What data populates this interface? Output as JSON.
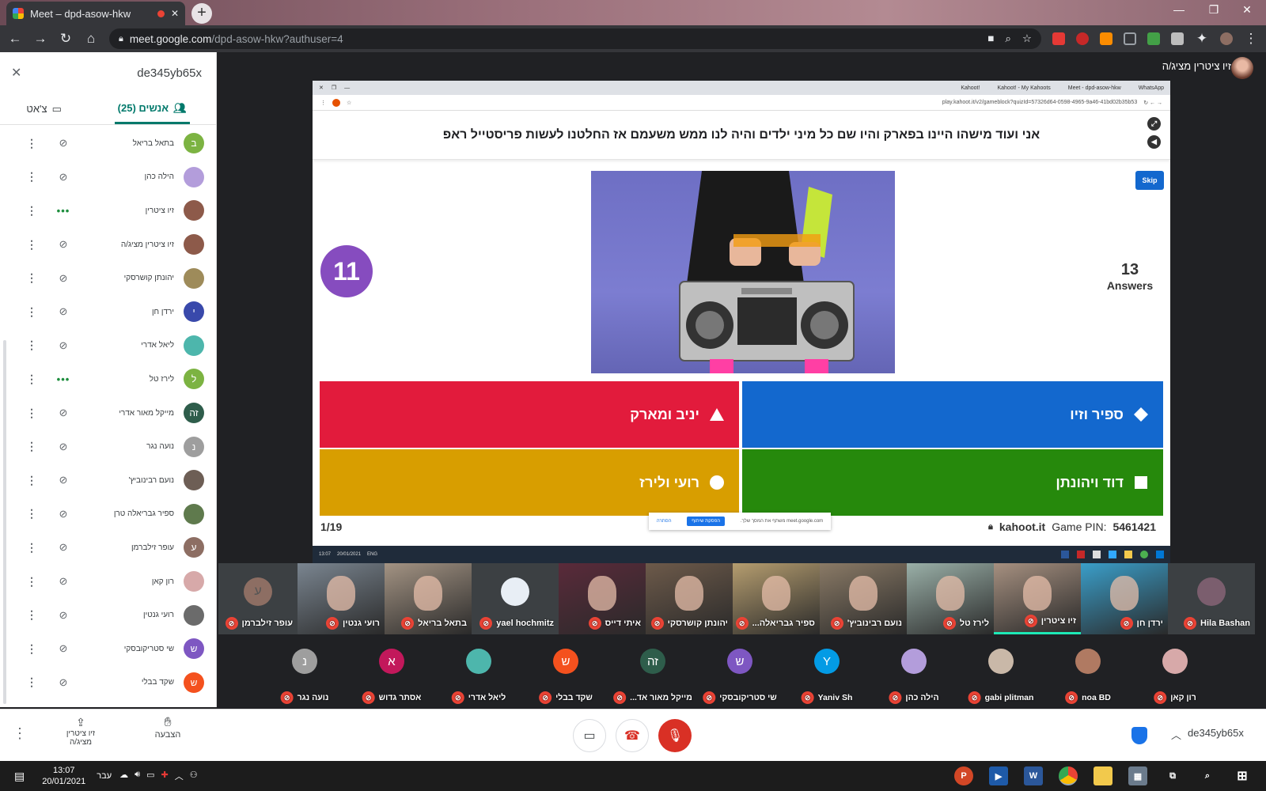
{
  "browser": {
    "tab_title": "Meet – dpd-asow-hkw",
    "new_tab": "+",
    "url_host": "meet.google.com",
    "url_path": "/dpd-asow-hkw?authuser=4",
    "win_min": "—",
    "win_restore": "❐",
    "win_close": "✕",
    "tab_close": "✕"
  },
  "panel": {
    "meeting_code": "de345yb65x",
    "close": "✕",
    "tab_people": "אנשים (25)",
    "tab_chat": "צ'אט",
    "participants": [
      {
        "name": "בתאל בריאל",
        "initial": "ב",
        "color": "#7cb342",
        "mic": "muted"
      },
      {
        "name": "הילה כהן",
        "initial": "",
        "color": "#b39ddb",
        "mic": "muted"
      },
      {
        "name": "זיו ציטרין",
        "initial": "",
        "color": "#8d5a4a",
        "mic": "talking"
      },
      {
        "name": "זיו ציטרין מציג/ה",
        "initial": "",
        "color": "#8d5a4a",
        "mic": "present"
      },
      {
        "name": "יהונתן קושרסקי",
        "initial": "",
        "color": "#9e8b5a",
        "mic": "muted"
      },
      {
        "name": "ירדן חן",
        "initial": "י",
        "color": "#3949ab",
        "mic": "muted"
      },
      {
        "name": "ליאל אדרי",
        "initial": "",
        "color": "#4db6ac",
        "mic": "muted"
      },
      {
        "name": "לירז טל",
        "initial": "ל",
        "color": "#7cb342",
        "mic": "talking"
      },
      {
        "name": "מייקל מאור אדרי",
        "initial": "זה",
        "color": "#2e5d4b",
        "mic": "muted"
      },
      {
        "name": "נועה נגר",
        "initial": "נ",
        "color": "#9e9e9e",
        "mic": "muted"
      },
      {
        "name": "נועם רבינוביץ'",
        "initial": "",
        "color": "#6d5e55",
        "mic": "muted"
      },
      {
        "name": "ספיר גבריאלה טרן",
        "initial": "",
        "color": "#5f7a4d",
        "mic": "muted"
      },
      {
        "name": "עופר זילברמן",
        "initial": "ע",
        "color": "#8d6e63",
        "mic": "muted"
      },
      {
        "name": "רון קאן",
        "initial": "",
        "color": "#d7a9a9",
        "mic": "muted"
      },
      {
        "name": "רועי גנטין",
        "initial": "",
        "color": "#6b6b6b",
        "mic": "muted"
      },
      {
        "name": "שי סטריקובסקי",
        "initial": "ש",
        "color": "#7e57c2",
        "mic": "muted"
      },
      {
        "name": "שקד בבלי",
        "initial": "ש",
        "color": "#f4511e",
        "mic": "muted"
      }
    ]
  },
  "presenter": {
    "label": "זיו ציטרין מציג/ה"
  },
  "shared": {
    "inner_tabs": [
      "Kahoot!",
      "Kahoot! - My Kahoots",
      "Meet - dpd-asow-hkw",
      "WhatsApp"
    ],
    "inner_url": "play.kahoot.it/v2/gameblock?quizId=57326d64-0598-4965-9a46-41bd02b35b53",
    "question": "אני ועוד מישהו היינו בפארק והיו שם כל מיני ילדים והיה לנו ממש משעמם אז החלטנו לעשות פריסטייל ראפ",
    "timer": "11",
    "skip": "Skip",
    "answers_count": "13",
    "answers_label": "Answers",
    "answers": {
      "red": "יניב ומארק",
      "blue": "ספיר וזיו",
      "yellow": "רועי ולירז",
      "green": "דוד ויהונתן"
    },
    "progress": "1/19",
    "site": "kahoot.it",
    "pin_label": "Game PIN:",
    "pin": "5461421",
    "share_msg": "meet.google.com משתף את המסך שלך.",
    "share_stop": "הפסקת שיתוף",
    "share_hide": "הסתרה",
    "inner_time": "13:07",
    "inner_date": "20/01/2021",
    "inner_lang": "ENG"
  },
  "tiles_row1": [
    {
      "name": "עופר זילברמן",
      "kind": "avatar",
      "initial": "ע",
      "color": "#8d6e63"
    },
    {
      "name": "רועי גנטין",
      "kind": "video",
      "color": "#7a8590"
    },
    {
      "name": "בתאל בריאל",
      "kind": "video",
      "color": "#a39383"
    },
    {
      "name": "yael hochmitz",
      "kind": "avatar",
      "initial": "",
      "color": "#e8eef5"
    },
    {
      "name": "איתי דייס",
      "kind": "video",
      "color": "#5a2a3a"
    },
    {
      "name": "יהונתן קושרסקי",
      "kind": "video",
      "color": "#6d5a4a"
    },
    {
      "name": "ספיר גבריאלה...",
      "kind": "video",
      "color": "#b59d6f"
    },
    {
      "name": "נועם רבינוביץ'",
      "kind": "video",
      "color": "#8a7a66"
    },
    {
      "name": "לירז טל",
      "kind": "video",
      "color": "#9ab0a8"
    },
    {
      "name": "זיו ציטרין",
      "kind": "video",
      "color": "#a69080"
    },
    {
      "name": "ירדן חן",
      "kind": "video",
      "color": "#3a9ec9"
    },
    {
      "name": "Hila Bashan",
      "kind": "avatar",
      "initial": "",
      "color": "#7b5e6e"
    }
  ],
  "tiles_row2": [
    {
      "name": "נועה נגר",
      "initial": "נ",
      "color": "#9e9e9e"
    },
    {
      "name": "אסתר גדוש",
      "initial": "א",
      "color": "#c2185b"
    },
    {
      "name": "ליאל אדרי",
      "initial": "",
      "color": "#4db6ac"
    },
    {
      "name": "שקד בבלי",
      "initial": "ש",
      "color": "#f4511e"
    },
    {
      "name": "מייקל מאור אד...",
      "initial": "זה",
      "color": "#2e5d4b"
    },
    {
      "name": "שי סטריקובסקי",
      "initial": "ש",
      "color": "#7e57c2"
    },
    {
      "name": "Yaniv Sh",
      "initial": "Y",
      "color": "#039be5"
    },
    {
      "name": "הילה כהן",
      "initial": "",
      "color": "#b39ddb"
    },
    {
      "name": "gabi plitman",
      "initial": "",
      "color": "#c9b8a8"
    },
    {
      "name": "noa BD",
      "initial": "",
      "color": "#b07a62"
    },
    {
      "name": "רון קאן",
      "initial": "",
      "color": "#d7a9a9"
    }
  ],
  "meetbar": {
    "raise_hand": "הצבעה",
    "presenting": "זיו ציטרין מציג/ה",
    "meeting_code": "de345yb65x"
  },
  "taskbar": {
    "time": "13:07",
    "date": "20/01/2021",
    "lang": "עבר"
  },
  "colors": {
    "kahoot_red": "#e21b3c",
    "kahoot_blue": "#1368ce",
    "kahoot_yellow": "#d89e00",
    "kahoot_green": "#26890c",
    "timer_purple": "#864cbf",
    "meet_teal": "#00796b",
    "end_call_red": "#ea4335"
  }
}
